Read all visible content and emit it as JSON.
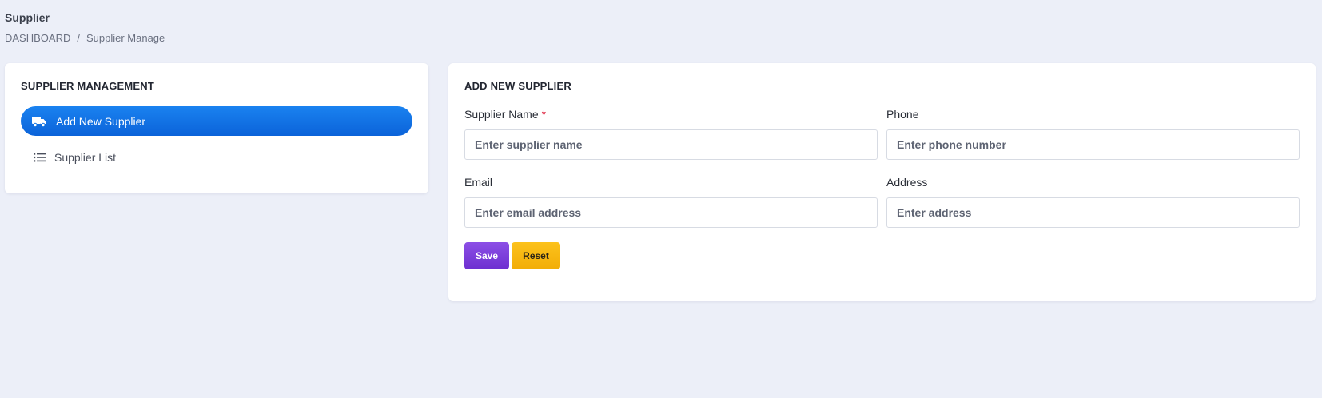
{
  "header": {
    "title": "Supplier",
    "breadcrumb": {
      "root": "DASHBOARD",
      "separator": "/",
      "current": "Supplier Manage"
    }
  },
  "sidebar": {
    "title": "SUPPLIER MANAGEMENT",
    "items": [
      {
        "label": "Add New Supplier",
        "icon": "truck-icon",
        "active": true
      },
      {
        "label": "Supplier List",
        "icon": "list-icon",
        "active": false
      }
    ]
  },
  "form": {
    "title": "ADD NEW SUPPLIER",
    "fields": {
      "name": {
        "label": "Supplier Name",
        "required_mark": "*",
        "placeholder": "Enter supplier name",
        "value": ""
      },
      "phone": {
        "label": "Phone",
        "placeholder": "Enter phone number",
        "value": ""
      },
      "email": {
        "label": "Email",
        "placeholder": "Enter email address",
        "value": ""
      },
      "address": {
        "label": "Address",
        "placeholder": "Enter address",
        "value": ""
      }
    },
    "buttons": {
      "save": "Save",
      "reset": "Reset"
    }
  },
  "colors": {
    "background": "#eceff8",
    "primary": "#0b6fe0",
    "save": "#7b3fe0",
    "reset": "#f8b70f",
    "required": "#e0314b"
  }
}
